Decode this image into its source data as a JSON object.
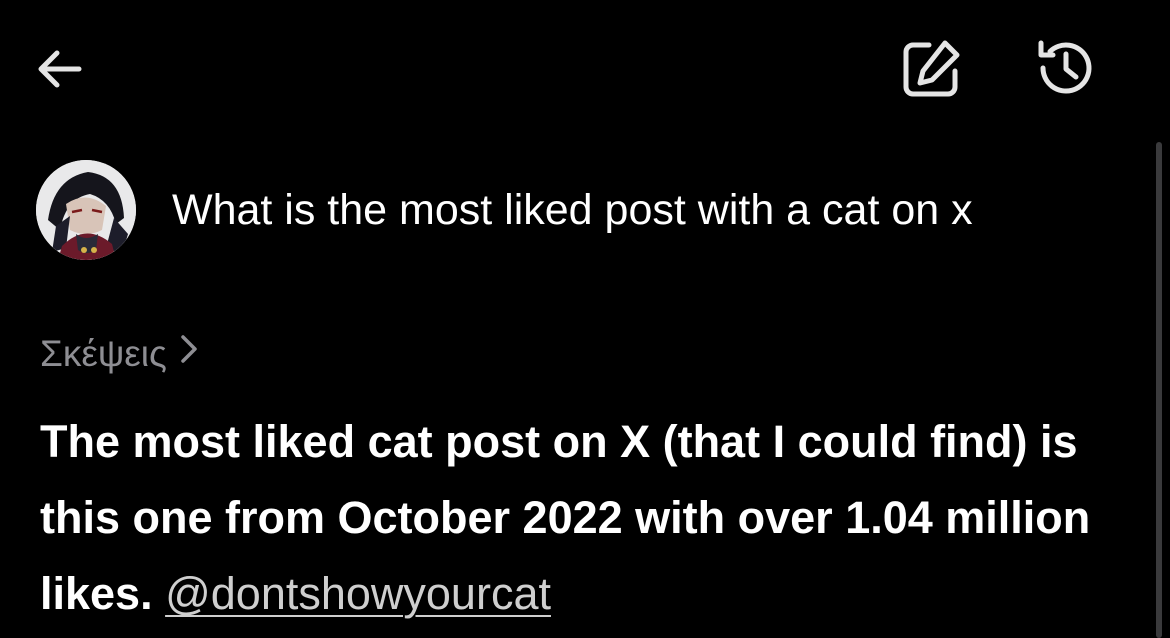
{
  "header": {
    "back_icon": "arrow-left-icon",
    "edit_icon": "edit-square-icon",
    "history_icon": "history-clock-icon",
    "icon_color": "#e5e5e5"
  },
  "conversation": {
    "user_message": {
      "avatar": "user-avatar",
      "text": "What is the most liked post with a cat on x"
    },
    "thoughts_label": "Σκέψεις",
    "answer": {
      "text": "The most liked cat post on X (that I could find) is this one from October 2022 with over 1.04 million likes.",
      "mention": "@dontshowyourcat"
    }
  },
  "colors": {
    "background": "#000000",
    "primary_text": "#ffffff",
    "secondary_text": "#8e8e93",
    "link_text": "#cfcfcf",
    "scrollbar": "#3a3a3c"
  }
}
